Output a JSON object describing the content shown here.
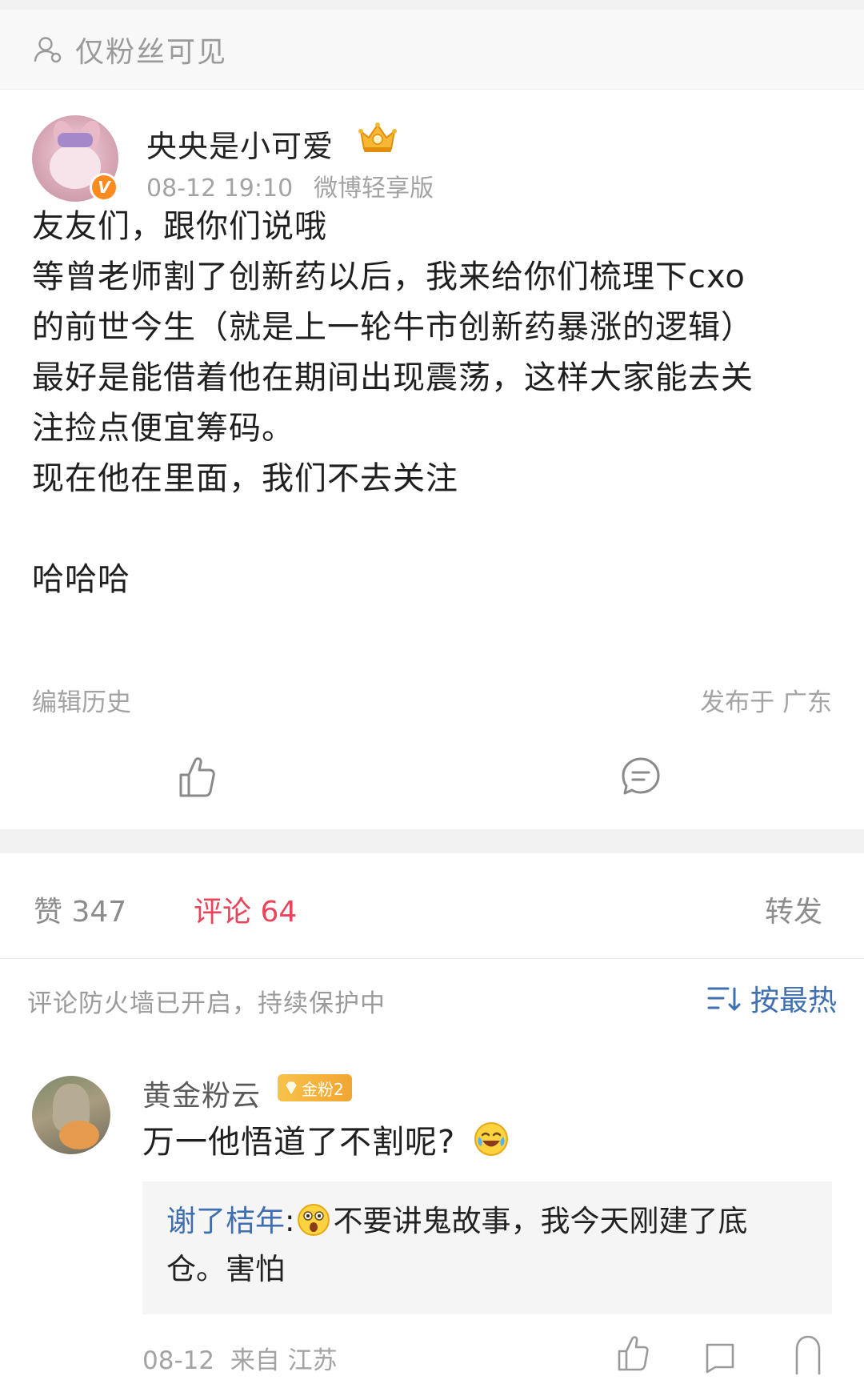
{
  "visibility": {
    "text": "仅粉丝可见",
    "icon": "user-icon"
  },
  "author": {
    "name": "央央是小可爱",
    "badge_icon": "crown-icon",
    "verified_mark": "V",
    "time": "08-12 19:10",
    "source": "微博轻享版"
  },
  "post": {
    "lines": [
      "友友们，跟你们说哦",
      "等曾老师割了创新药以后，我来给你们梳理下cxo",
      "的前世今生（就是上一轮牛市创新药暴涨的逻辑）",
      "最好是能借着他在期间出现震荡，这样大家能去关",
      "注捡点便宜筹码。",
      "现在他在里面，我们不去关注",
      "",
      "哈哈哈"
    ],
    "edit_history": "编辑历史",
    "location": "发布于 广东"
  },
  "actions": {
    "like_icon": "thumbs-up-icon",
    "comment_icon": "comment-bubble-icon"
  },
  "tabs": {
    "like": "赞 347",
    "comment": "评论 64",
    "repost": "转发"
  },
  "firewall": {
    "text": "评论防火墙已开启，持续保护中",
    "sort_label": "按最热"
  },
  "comment": {
    "username": "黄金粉云",
    "fan_badge": "金粉2",
    "text": "万一他悟道了不割呢?",
    "emoji": "laughing-crying-emoji",
    "reply": {
      "user": "谢了桔年",
      "colon": ":",
      "emoji": "shocked-emoji",
      "text_line1": "不要讲鬼故事，我今天刚建了底",
      "text_line2": "仓。害怕"
    },
    "date": "08-12",
    "from": "来自 江苏"
  },
  "colors": {
    "accent_red": "#e8445a",
    "link_blue": "#3f6fb0",
    "verified_orange": "#ff8a1f",
    "fan_gold": "#f2a532"
  }
}
